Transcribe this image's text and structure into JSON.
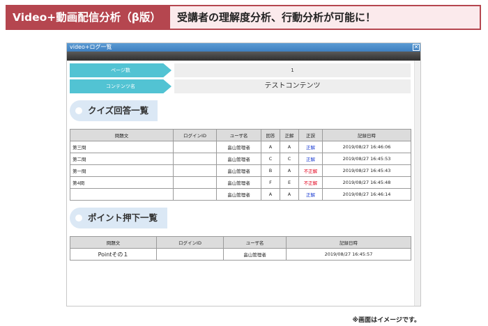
{
  "banner": {
    "title": "Video+動画配信分析（β版）",
    "subtitle": "受講者の理解度分析、行動分析が可能に！"
  },
  "window": {
    "title": "video+ログ一覧",
    "close_glyph": "✕"
  },
  "info": {
    "page_label": "ページ数",
    "page_value": "1",
    "content_label": "コンテンツ名",
    "content_value": "テストコンテンツ"
  },
  "quiz": {
    "title": "クイズ回答一覧",
    "headers": [
      "問題文",
      "ログインID",
      "ユーザ名",
      "回答",
      "正解",
      "正誤",
      "記録日時"
    ],
    "rows": [
      {
        "question": "第三問",
        "login_id": "",
        "user": "畠山管理者",
        "answer": "A",
        "correct": "A",
        "result": "正解",
        "datetime": "2019/08/27 16:46:06"
      },
      {
        "question": "第二問",
        "login_id": "",
        "user": "畠山管理者",
        "answer": "C",
        "correct": "C",
        "result": "正解",
        "datetime": "2019/08/27 16:45:53"
      },
      {
        "question": "第一問",
        "login_id": "",
        "user": "畠山管理者",
        "answer": "B",
        "correct": "A",
        "result": "不正解",
        "datetime": "2019/08/27 16:45:43"
      },
      {
        "question": "第4問",
        "login_id": "",
        "user": "畠山管理者",
        "answer": "F",
        "correct": "E",
        "result": "不正解",
        "datetime": "2019/08/27 16:45:48"
      },
      {
        "question": "",
        "login_id": "",
        "user": "畠山管理者",
        "answer": "A",
        "correct": "A",
        "result": "正解",
        "datetime": "2019/08/27 16:46:14"
      }
    ]
  },
  "points": {
    "title": "ポイント押下一覧",
    "headers": [
      "問題文",
      "ログインID",
      "ユーザ名",
      "記録日時"
    ],
    "rows": [
      {
        "question": "Pointその１",
        "login_id": "",
        "user": "畠山管理者",
        "datetime": "2019/08/27 16:45:57"
      }
    ]
  },
  "colors": {
    "banner": "#b5464f",
    "correct": "#1a3bd1",
    "incorrect": "#e3001b",
    "label": "#52c3d3"
  },
  "footnote": "※画面はイメージです。"
}
